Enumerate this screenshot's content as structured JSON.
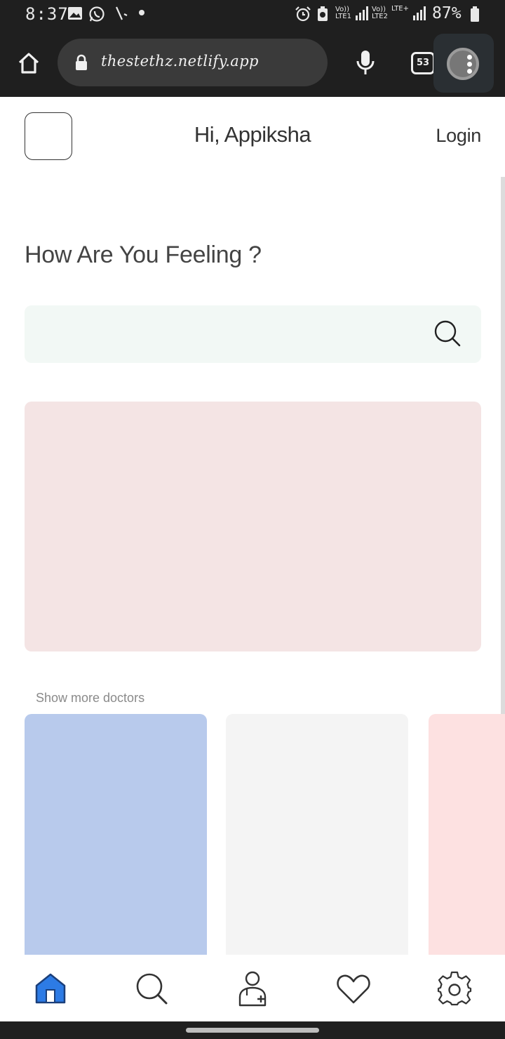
{
  "status_bar": {
    "time": "8:37",
    "sim1_label": "Vo)) LTE1",
    "sim2_label": "Vo)) LTE2",
    "sim2_type": "LTE+",
    "battery": "87%"
  },
  "browser": {
    "url": "thestethz.netlify.app",
    "tab_count": "53"
  },
  "header": {
    "greeting": "Hi, Appiksha",
    "login_label": "Login"
  },
  "main": {
    "heading": "How Are You Feeling ?",
    "show_more_label": "Show more doctors",
    "doctor_card_colors": [
      "#b8caec",
      "#f4f4f4",
      "#fde1e1"
    ]
  },
  "bottom_nav": {
    "items": [
      "home-icon",
      "search-icon",
      "doctor-icon",
      "heart-icon",
      "settings-icon"
    ],
    "active_color": "#2d7be5"
  }
}
